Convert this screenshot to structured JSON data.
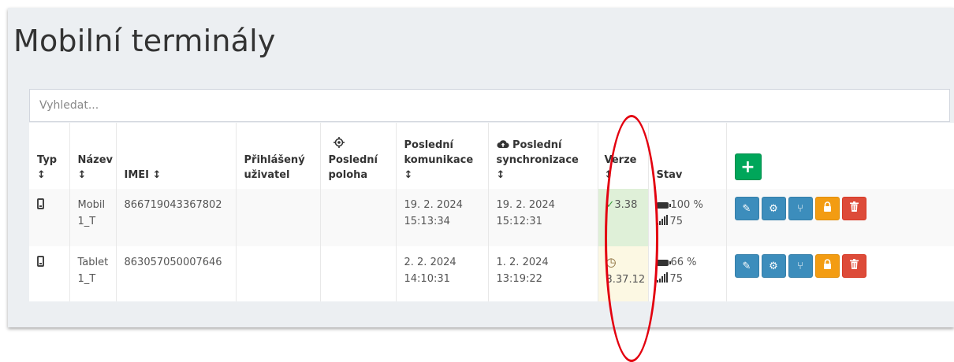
{
  "page": {
    "title": "Mobilní terminály"
  },
  "search": {
    "placeholder": "Vyhledat..."
  },
  "columns": {
    "typ": "Typ",
    "nazev": "Název",
    "imei": "IMEI",
    "uzivatel_line1": "Přihlášený",
    "uzivatel_line2": "uživatel",
    "poloha_line1": "Poslední",
    "poloha_line2": "poloha",
    "komunikace_line1": "Poslední",
    "komunikace_line2": "komunikace",
    "sync_line1": "Poslední",
    "sync_line2": "synchronizace",
    "verze": "Verze",
    "stav": "Stav",
    "sort_glyph": "↕",
    "add_glyph": "+"
  },
  "rows": [
    {
      "type_icon": "mobile-phone-icon",
      "name_line1": "Mobil",
      "name_line2": "1_T",
      "imei": "866719043367802",
      "user": "",
      "location": "",
      "last_comm_date": "19. 2. 2024",
      "last_comm_time": "15:13:34",
      "last_sync_date": "19. 2. 2024",
      "last_sync_time": "15:12:31",
      "version": "3.38",
      "version_status": "current",
      "battery": "100 %",
      "signal": "75"
    },
    {
      "type_icon": "mobile-phone-icon",
      "name_line1": "Tablet",
      "name_line2": "1_T",
      "imei": "863057050007646",
      "user": "",
      "location": "",
      "last_comm_date": "2. 2. 2024",
      "last_comm_time": "14:10:31",
      "last_sync_date": "1. 2. 2024",
      "last_sync_time": "13:19:22",
      "version": "3.37.12",
      "version_status": "outdated",
      "battery": "66 %",
      "signal": "75"
    }
  ],
  "glyphs": {
    "check": "✓",
    "clock": "◷"
  },
  "colors": {
    "primary_button": "#3c8dbc",
    "warning_button": "#f39c12",
    "danger_button": "#dd4b39",
    "success_button": "#00a65a",
    "version_ok_bg": "#dff0d8",
    "version_old_bg": "#fcf8e3",
    "annotation_red": "#e3000f"
  }
}
